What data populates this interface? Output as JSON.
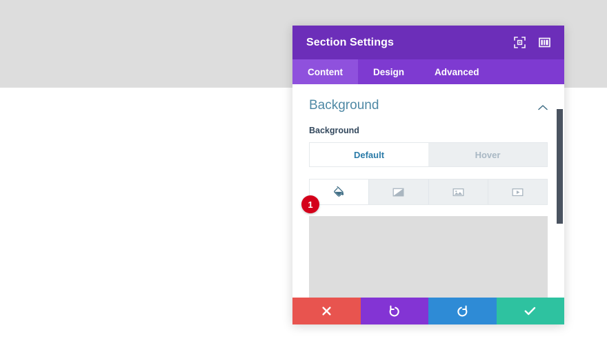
{
  "backdrop": {
    "top_band_color": "#dddddd",
    "body_color": "#ffffff"
  },
  "panel": {
    "title": "Section Settings",
    "header_color": "#6c2eb9",
    "tabbar_color": "#7e3ad1",
    "active_tab_color": "#8f51dd",
    "header_icons": [
      {
        "name": "fullscreen-icon",
        "label": "Expand Settings Modal"
      },
      {
        "name": "layout-columns-icon",
        "label": "Modal Position"
      }
    ],
    "tabs": [
      {
        "label": "Content",
        "active": true
      },
      {
        "label": "Design",
        "active": false
      },
      {
        "label": "Advanced",
        "active": false
      }
    ],
    "section": {
      "title": "Background",
      "collapse_icon": "chevron-up-icon",
      "title_color": "#4f89a5"
    },
    "field": {
      "label": "Background"
    },
    "state_toggle": {
      "options": [
        {
          "label": "Default",
          "active": true
        },
        {
          "label": "Hover",
          "active": false
        }
      ],
      "active_text_color": "#2b7ba8",
      "inactive_text_color": "#a9b8c4"
    },
    "background_types": [
      {
        "name": "background-color-icon",
        "label": "Background Color",
        "active": true
      },
      {
        "name": "background-gradient-icon",
        "label": "Background Gradient",
        "active": false
      },
      {
        "name": "background-image-icon",
        "label": "Background Image",
        "active": false
      },
      {
        "name": "background-video-icon",
        "label": "Background Video",
        "active": false
      }
    ],
    "preview": {
      "name": "background-color-preview",
      "color": "#dddddd"
    },
    "step_badge": {
      "number": "1",
      "color": "#d4001a"
    },
    "scrollbar": {
      "thumb_color": "#4a5360"
    },
    "footer_buttons": [
      {
        "name": "cancel-button",
        "icon": "close-icon",
        "label": "Discard Changes",
        "color": "#e8544f"
      },
      {
        "name": "undo-button",
        "icon": "undo-icon",
        "label": "Undo",
        "color": "#8334d4"
      },
      {
        "name": "redo-button",
        "icon": "redo-icon",
        "label": "Redo",
        "color": "#2e8bd6"
      },
      {
        "name": "save-button",
        "icon": "check-icon",
        "label": "Save Changes",
        "color": "#2ec2a0"
      }
    ]
  }
}
